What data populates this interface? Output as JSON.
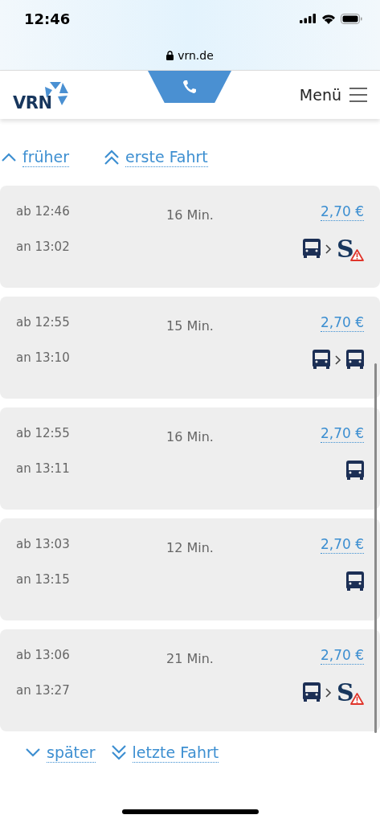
{
  "status_bar": {
    "time": "12:46"
  },
  "browser": {
    "url": "vrn.de"
  },
  "header": {
    "logo": "VRN",
    "menu_label": "Menü"
  },
  "top_links": [
    {
      "kind": "single",
      "label": "früher"
    },
    {
      "kind": "double",
      "label": "erste Fahrt"
    }
  ],
  "journeys": [
    {
      "departure": "ab 12:46",
      "arrival": "an 13:02",
      "duration": "16 Min.",
      "price": "2,70 €",
      "legs": [
        {
          "kind": "bus"
        },
        {
          "kind": "sbahn",
          "label": "S",
          "warning": true
        }
      ]
    },
    {
      "departure": "ab 12:55",
      "arrival": "an 13:10",
      "duration": "15 Min.",
      "price": "2,70 €",
      "legs": [
        {
          "kind": "bus"
        },
        {
          "kind": "bus"
        }
      ]
    },
    {
      "departure": "ab 12:55",
      "arrival": "an 13:11",
      "duration": "16 Min.",
      "price": "2,70 €",
      "legs": [
        {
          "kind": "bus"
        }
      ]
    },
    {
      "departure": "ab 13:03",
      "arrival": "an 13:15",
      "duration": "12 Min.",
      "price": "2,70 €",
      "legs": [
        {
          "kind": "bus"
        }
      ]
    },
    {
      "departure": "ab 13:06",
      "arrival": "an 13:27",
      "duration": "21 Min.",
      "price": "2,70 €",
      "legs": [
        {
          "kind": "bus"
        },
        {
          "kind": "sbahn",
          "label": "S",
          "warning": true
        }
      ]
    }
  ],
  "bottom_links": [
    {
      "kind": "single",
      "label": "später"
    },
    {
      "kind": "double",
      "label": "letzte Fahrt"
    }
  ]
}
